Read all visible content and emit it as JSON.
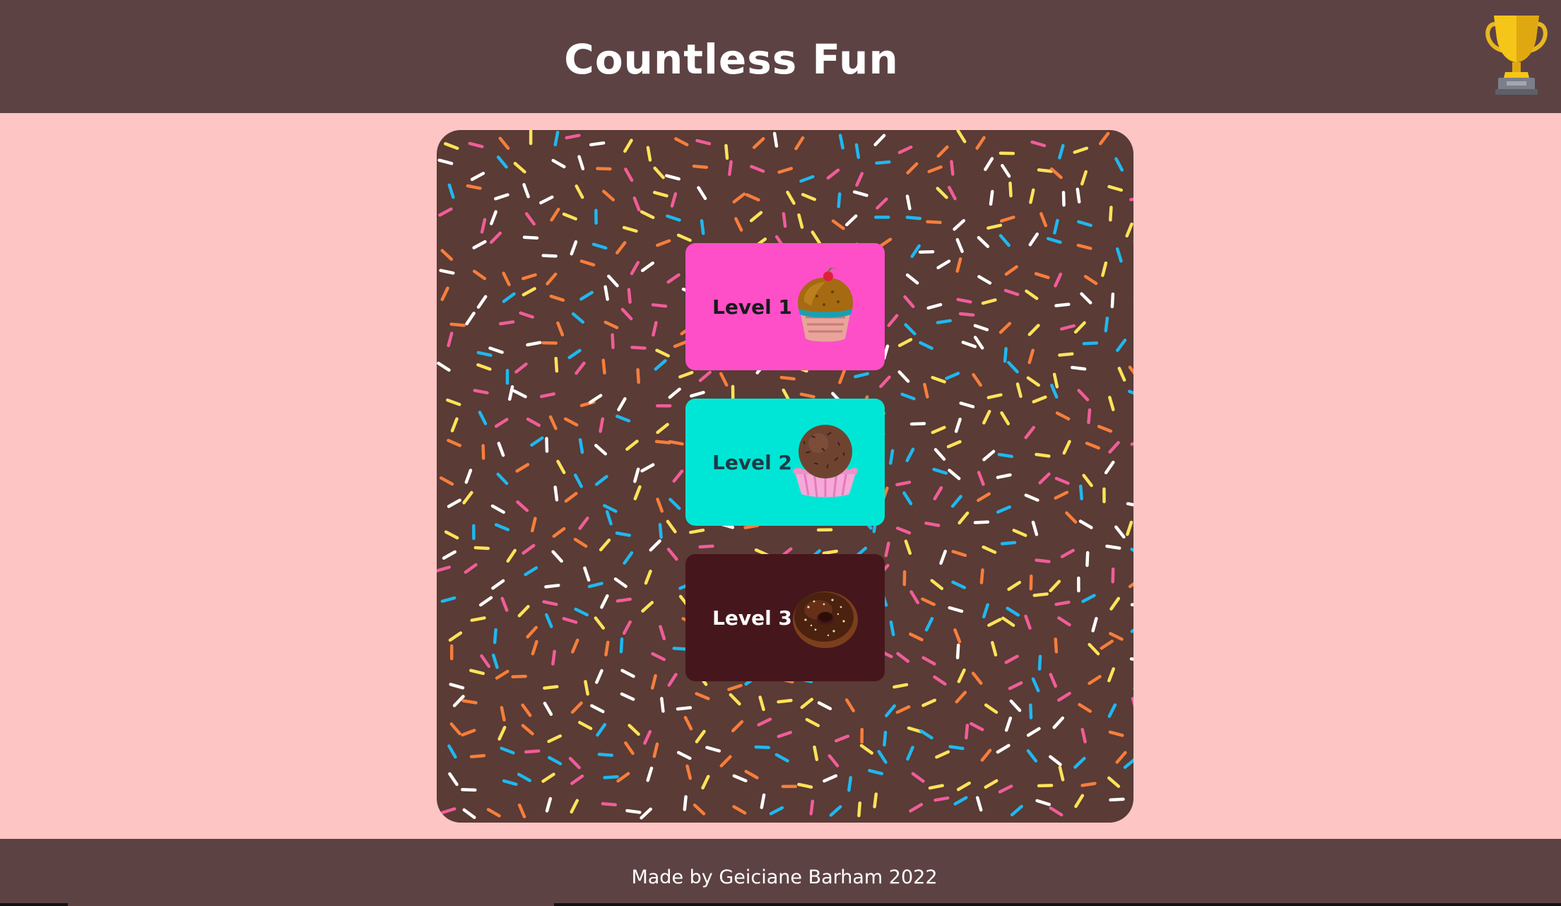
{
  "header": {
    "title": "Countless Fun",
    "trophy_icon": "trophy-icon",
    "background": "#5d4244"
  },
  "page": {
    "background": "#fec5c5"
  },
  "board": {
    "background": "#5a3b35",
    "sprinkle_colors": [
      "#ffffff",
      "#ffe35a",
      "#1fb8f0",
      "#f77e3c",
      "#f05d9a"
    ]
  },
  "levels": [
    {
      "label": "Level 1",
      "icon": "cupcake-icon",
      "card_color": "#fe4fc8",
      "text_color": "#1a1a1a"
    },
    {
      "label": "Level 2",
      "icon": "chocolate-cupcake-icon",
      "card_color": "#00e6d6",
      "text_color": "#1e3a45"
    },
    {
      "label": "Level 3",
      "icon": "donut-icon",
      "card_color": "#46161d",
      "text_color": "#ffffff"
    }
  ],
  "footer": {
    "text": "Made by Geiciane Barham 2022"
  }
}
